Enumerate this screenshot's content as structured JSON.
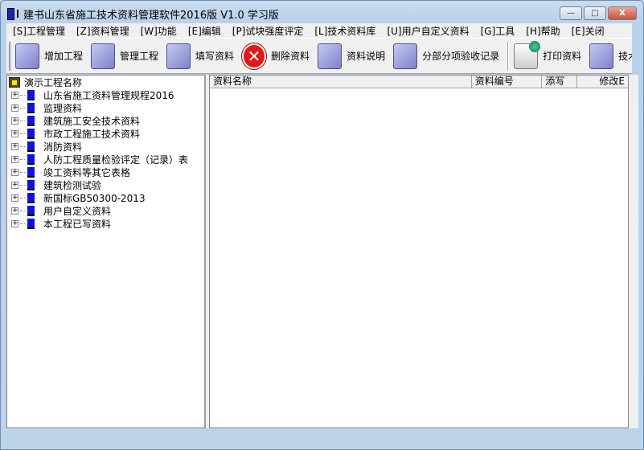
{
  "window": {
    "title": "建书山东省施工技术资料管理软件2016版 V1.0 学习版",
    "controls": [
      "—",
      "□",
      "X"
    ]
  },
  "menu": [
    "[S]工程管理",
    "[Z]资料管理",
    "[W]功能",
    "[E]编辑",
    "[P]试块强度评定",
    "[L]技术资料库",
    "[U]用户自定义资料",
    "[G]工具",
    "[H]帮助",
    "[E]关闭"
  ],
  "toolbar": [
    {
      "label": "增加工程",
      "icon": "add-project-icon"
    },
    {
      "label": "管理工程",
      "icon": "manage-project-icon"
    },
    {
      "label": "填写资料",
      "icon": "edit-document-icon"
    },
    {
      "label": "删除资料",
      "icon": "delete-icon"
    },
    {
      "label": "资料说明",
      "icon": "document-info-icon"
    },
    {
      "label": "分部分项验收记录",
      "icon": "acceptance-record-icon"
    },
    {
      "label": "打印资料",
      "icon": "printer-icon"
    },
    {
      "label": "技术资",
      "icon": "tech-library-icon"
    }
  ],
  "tree": {
    "root": "演示工程名称",
    "items": [
      "山东省施工资料管理规程2016",
      "监理资料",
      "建筑施工安全技术资料",
      "市政工程施工技术资料",
      "消防资料",
      "人防工程质量检验评定（记录）表",
      "竣工资料等其它表格",
      "建筑检测试验",
      "新国标GB50300-2013",
      "用户自定义资料",
      "本工程已写资料"
    ]
  },
  "list": {
    "columns": [
      "资料名称",
      "资料编号",
      "添写",
      "修改E"
    ]
  }
}
